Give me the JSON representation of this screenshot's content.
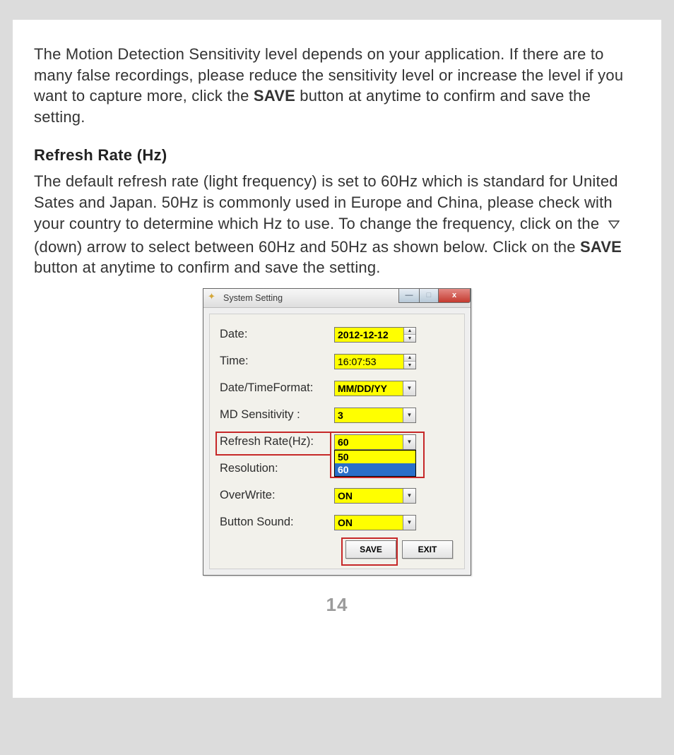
{
  "doc": {
    "para1_a": "The Motion Detection Sensitivity level depends on your application. If there are to many false recordings, please reduce the sensitivity level or increase the level if you want to capture more, click the ",
    "save_word": "SAVE",
    "para1_b": " button at anytime to confirm and save the setting.",
    "heading": "Refresh Rate (Hz)",
    "para2_a": "The default refresh rate (light frequency) is set to 60Hz which is standard for United Sates and Japan. 50Hz is commonly used in Europe and China, please check with your country to determine which Hz to use. To change the frequency, click on the ",
    "para2_b": " (down) arrow to select between 60Hz and 50Hz as shown below. Click on the ",
    "para2_c": " button at anytime to confirm and save the setting.",
    "page_number": "14"
  },
  "dialog": {
    "title": "System Setting",
    "labels": {
      "date": "Date:",
      "time": "Time:",
      "fmt": "Date/TimeFormat:",
      "md": "MD Sensitivity :",
      "rr": "Refresh Rate(Hz):",
      "res": "Resolution:",
      "ow": "OverWrite:",
      "bs": "Button Sound:"
    },
    "values": {
      "date": "2012-12-12",
      "time": "16:07:53",
      "fmt": "MM/DD/YY",
      "md": "3",
      "rr": "60",
      "ow": "ON",
      "bs": "ON"
    },
    "dropdown_options": {
      "opt1": "50",
      "opt2": "60"
    },
    "buttons": {
      "save": "SAVE",
      "exit": "EXIT"
    },
    "win": {
      "min": "—",
      "max": "□",
      "close": "x"
    }
  }
}
